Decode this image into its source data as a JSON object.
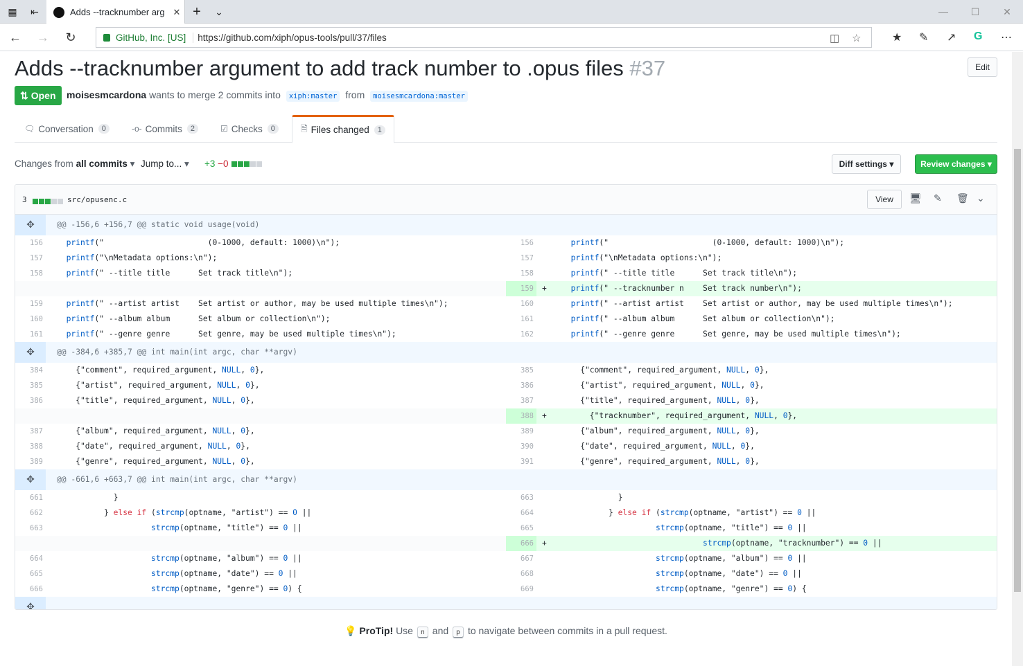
{
  "browser": {
    "tab_title": "Adds --tracknumber arg",
    "cert": "GitHub, Inc. [US]",
    "url": "https://github.com/xiph/opus-tools/pull/37/files"
  },
  "pr": {
    "title": "Adds --tracknumber argument to add track number to .opus files",
    "number": "#37",
    "edit_label": "Edit",
    "state": "Open",
    "author": "moisesmcardona",
    "merge_text_1": "wants to merge 2 commits into",
    "base": "xiph:master",
    "from_text": "from",
    "head": "moisesmcardona:master"
  },
  "tabs": [
    {
      "label": "Conversation",
      "count": "0"
    },
    {
      "label": "Commits",
      "count": "2"
    },
    {
      "label": "Checks",
      "count": "0"
    },
    {
      "label": "Files changed",
      "count": "1"
    }
  ],
  "toolbar": {
    "changes_from": "Changes from",
    "all_commits": "all commits",
    "jump_to": "Jump to...",
    "additions": "+3",
    "deletions": "−0",
    "diff_settings": "Diff settings",
    "review_changes": "Review changes"
  },
  "file": {
    "changes": "3",
    "path": "src/opusenc.c",
    "view_label": "View"
  },
  "hunks": [
    {
      "header": "@@ -156,6 +156,7 @@ static void usage(void)",
      "rows": [
        {
          "l": "156",
          "lc": "  printf(\"                      (0-1000, default: 1000)\\n\");",
          "r": "156",
          "rc": "  printf(\"                      (0-1000, default: 1000)\\n\");"
        },
        {
          "l": "157",
          "lc": "  printf(\"\\nMetadata options:\\n\");",
          "r": "157",
          "rc": "  printf(\"\\nMetadata options:\\n\");"
        },
        {
          "l": "158",
          "lc": "  printf(\" --title title      Set track title\\n\");",
          "r": "158",
          "rc": "  printf(\" --title title      Set track title\\n\");"
        },
        {
          "l": "",
          "lc": "",
          "r": "159",
          "rc": "  printf(\" --tracknumber n    Set track number\\n\");",
          "add": true
        },
        {
          "l": "159",
          "lc": "  printf(\" --artist artist    Set artist or author, may be used multiple times\\n\");",
          "r": "160",
          "rc": "  printf(\" --artist artist    Set artist or author, may be used multiple times\\n\");"
        },
        {
          "l": "160",
          "lc": "  printf(\" --album album      Set album or collection\\n\");",
          "r": "161",
          "rc": "  printf(\" --album album      Set album or collection\\n\");"
        },
        {
          "l": "161",
          "lc": "  printf(\" --genre genre      Set genre, may be used multiple times\\n\");",
          "r": "162",
          "rc": "  printf(\" --genre genre      Set genre, may be used multiple times\\n\");"
        }
      ]
    },
    {
      "header": "@@ -384,6 +385,7 @@ int main(int argc, char **argv)",
      "rows": [
        {
          "l": "384",
          "lc": "    {\"comment\", required_argument, NULL, 0},",
          "r": "385",
          "rc": "    {\"comment\", required_argument, NULL, 0},"
        },
        {
          "l": "385",
          "lc": "    {\"artist\", required_argument, NULL, 0},",
          "r": "386",
          "rc": "    {\"artist\", required_argument, NULL, 0},"
        },
        {
          "l": "386",
          "lc": "    {\"title\", required_argument, NULL, 0},",
          "r": "387",
          "rc": "    {\"title\", required_argument, NULL, 0},"
        },
        {
          "l": "",
          "lc": "",
          "r": "388",
          "rc": "      {\"tracknumber\", required_argument, NULL, 0},",
          "add": true
        },
        {
          "l": "387",
          "lc": "    {\"album\", required_argument, NULL, 0},",
          "r": "389",
          "rc": "    {\"album\", required_argument, NULL, 0},"
        },
        {
          "l": "388",
          "lc": "    {\"date\", required_argument, NULL, 0},",
          "r": "390",
          "rc": "    {\"date\", required_argument, NULL, 0},"
        },
        {
          "l": "389",
          "lc": "    {\"genre\", required_argument, NULL, 0},",
          "r": "391",
          "rc": "    {\"genre\", required_argument, NULL, 0},"
        }
      ]
    },
    {
      "header": "@@ -661,6 +663,7 @@ int main(int argc, char **argv)",
      "rows": [
        {
          "l": "661",
          "lc": "            }",
          "r": "663",
          "rc": "            }"
        },
        {
          "l": "662",
          "lc": "          } else if (strcmp(optname, \"artist\") == 0 ||",
          "r": "664",
          "rc": "          } else if (strcmp(optname, \"artist\") == 0 ||"
        },
        {
          "l": "663",
          "lc": "                    strcmp(optname, \"title\") == 0 ||",
          "r": "665",
          "rc": "                    strcmp(optname, \"title\") == 0 ||"
        },
        {
          "l": "",
          "lc": "",
          "r": "666",
          "rc": "                              strcmp(optname, \"tracknumber\") == 0 ||",
          "add": true
        },
        {
          "l": "664",
          "lc": "                    strcmp(optname, \"album\") == 0 ||",
          "r": "667",
          "rc": "                    strcmp(optname, \"album\") == 0 ||"
        },
        {
          "l": "665",
          "lc": "                    strcmp(optname, \"date\") == 0 ||",
          "r": "668",
          "rc": "                    strcmp(optname, \"date\") == 0 ||"
        },
        {
          "l": "666",
          "lc": "                    strcmp(optname, \"genre\") == 0) {",
          "r": "669",
          "rc": "                    strcmp(optname, \"genre\") == 0) {"
        }
      ]
    }
  ],
  "protip": {
    "label": "ProTip!",
    "use": "Use",
    "key_n": "n",
    "and": "and",
    "key_p": "p",
    "rest": "to navigate between commits in a pull request."
  }
}
